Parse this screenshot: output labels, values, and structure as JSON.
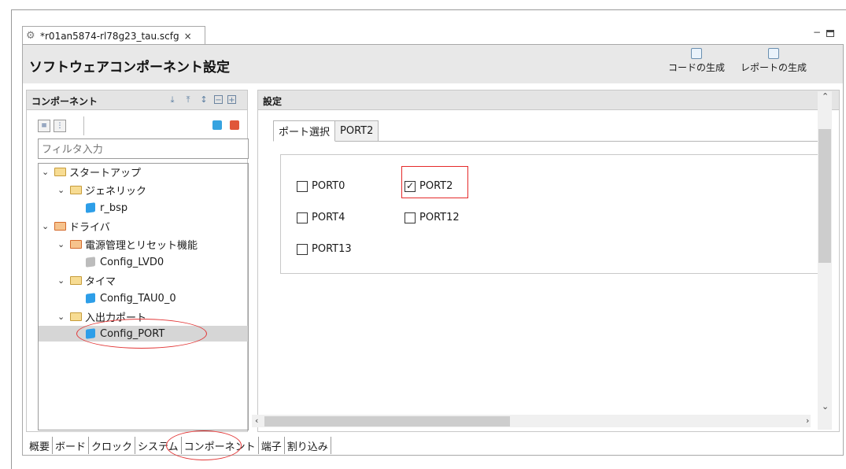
{
  "editor_tab": {
    "title": "*r01an5874-rl78g23_tau.scfg",
    "close": "×"
  },
  "window_controls": {
    "minimize": "−",
    "maximize": ""
  },
  "header": {
    "title": "ソフトウェアコンポーネント設定",
    "generate_code": "コードの生成",
    "generate_report": "レポートの生成"
  },
  "components_panel": {
    "title": "コンポーネント",
    "filter_placeholder": "フィルタ入力",
    "tree": [
      {
        "label": "スタートアップ",
        "level": 0,
        "type": "folder"
      },
      {
        "label": "ジェネリック",
        "level": 1,
        "type": "folder"
      },
      {
        "label": "r_bsp",
        "level": 2,
        "type": "component"
      },
      {
        "label": "ドライバ",
        "level": 0,
        "type": "folder"
      },
      {
        "label": "電源管理とリセット機能",
        "level": 1,
        "type": "folder"
      },
      {
        "label": "Config_LVD0",
        "level": 2,
        "type": "component-disabled"
      },
      {
        "label": "タイマ",
        "level": 1,
        "type": "folder"
      },
      {
        "label": "Config_TAU0_0",
        "level": 2,
        "type": "component"
      },
      {
        "label": "入出力ポート",
        "level": 1,
        "type": "folder"
      },
      {
        "label": "Config_PORT",
        "level": 2,
        "type": "component",
        "selected": true
      }
    ]
  },
  "settings_panel": {
    "title": "設定",
    "tabs": [
      "ポート選択",
      "PORT2"
    ],
    "active_tab": "ポート選択",
    "ports": [
      {
        "label": "PORT0",
        "checked": false
      },
      {
        "label": "PORT2",
        "checked": true
      },
      {
        "label": "PORT4",
        "checked": false
      },
      {
        "label": "PORT12",
        "checked": false
      },
      {
        "label": "PORT13",
        "checked": false
      }
    ]
  },
  "bottom_tabs": [
    "概要",
    "ボード",
    "クロック",
    "システム",
    "コンポーネント",
    "端子",
    "割り込み"
  ],
  "colors": {
    "annotation": "#e23636",
    "header_bg": "#e8e8e8",
    "selection": "#d6d6d6"
  }
}
